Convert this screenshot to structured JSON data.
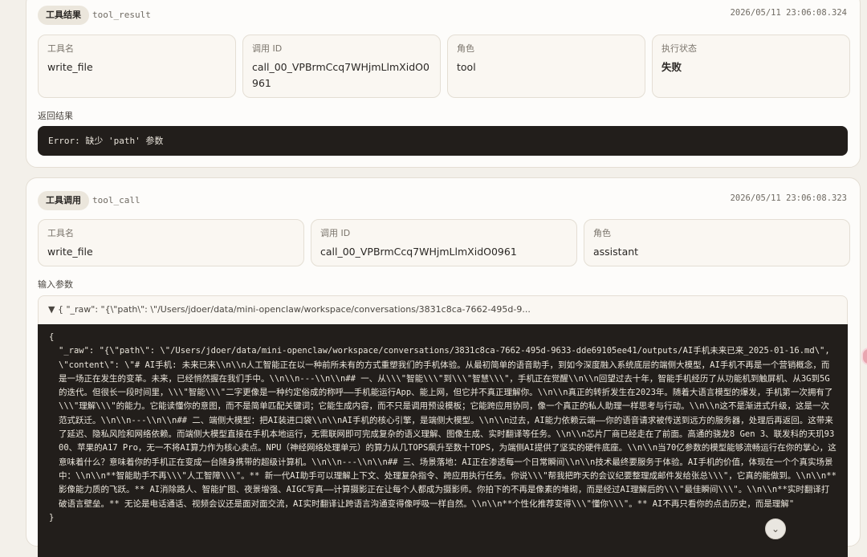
{
  "result_card": {
    "badge": "工具结果",
    "tag": "tool_result",
    "timestamp": "2026/05/11 23:06:08.324",
    "fields": [
      {
        "label": "工具名",
        "value": "write_file"
      },
      {
        "label": "调用 ID",
        "value": "call_00_VPBrmCcq7WHjmLlmXidO0961"
      },
      {
        "label": "角色",
        "value": "tool"
      },
      {
        "label": "执行状态",
        "value": "失败"
      }
    ],
    "return_label": "返回结果",
    "return_value": "Error: 缺少 'path' 参数"
  },
  "call_card": {
    "badge": "工具调用",
    "tag": "tool_call",
    "timestamp": "2026/05/11 23:06:08.323",
    "fields": [
      {
        "label": "工具名",
        "value": "write_file"
      },
      {
        "label": "调用 ID",
        "value": "call_00_VPBrmCcq7WHjmLlmXidO0961"
      },
      {
        "label": "角色",
        "value": "assistant"
      }
    ],
    "params_label": "输入参数",
    "collapse_summary": "▼ { \"_raw\": \"{\\\"path\\\": \\\"/Users/jdoer/data/mini-openclaw/workspace/conversations/3831c8ca-7662-495d-9...",
    "json_open": "{",
    "json_body": "\"_raw\": \"{\\\"path\\\": \\\"/Users/jdoer/data/mini-openclaw/workspace/conversations/3831c8ca-7662-495d-9633-dde69105ee41/outputs/AI手机未来已来_2025-01-16.md\\\", \\\"content\\\": \\\"# AI手机: 未来已来\\\\n\\\\n人工智能正在以一种前所未有的方式重塑我们的手机体验。从最初简单的语音助手，到如今深度融入系统底层的端侧大模型，AI手机不再是一个营销概念，而是一场正在发生的变革。未来，已经悄然握在我们手中。\\\\n\\\\n---\\\\n\\\\n## 一、从\\\\\\\"智能\\\\\\\"到\\\\\\\"智慧\\\\\\\"，手机正在觉醒\\\\n\\\\n回望过去十年，智能手机经历了从功能机到触屏机、从3G到5G的迭代。但很长一段时间里，\\\\\\\"智能\\\\\\\"二字更像是一种约定俗成的称呼——手机能运行App、能上网，但它并不真正理解你。\\\\n\\\\n真正的转折发生在2023年。随着大语言模型的爆发，手机第一次拥有了\\\\\\\"理解\\\\\\\"的能力。它能读懂你的意图，而不是简单匹配关键词；它能生成内容，而不只是调用预设模板；它能跨应用协同，像一个真正的私人助理一样思考与行动。\\\\n\\\\n这不是渐进式升级，这是一次范式跃迁。\\\\n\\\\n---\\\\n\\\\n## 二、端侧大模型：把AI装进口袋\\\\n\\\\nAI手机的核心引擎，是端侧大模型。\\\\n\\\\n过去，AI能力依赖云端——你的语音请求被传送到远方的服务器，处理后再返回。这带来了延迟、隐私风险和网络依赖。而端侧大模型直接在手机本地运行，无需联网即可完成复杂的语义理解、图像生成、实时翻译等任务。\\\\n\\\\n芯片厂商已经走在了前面。高通的骁龙8 Gen 3、联发科的天玑9300、苹果的A17 Pro，无一不将AI算力作为核心卖点。NPU（神经网络处理单元）的算力从几TOPS飙升至数十TOPS，为端侧AI提供了坚实的硬件底座。\\\\n\\\\n当70亿参数的模型能够流畅运行在你的掌心，这意味着什么？意味着你的手机正在变成一台随身携带的超级计算机。\\\\n\\\\n---\\\\n\\\\n## 三、场景落地：AI正在渗透每一个日常瞬间\\\\n\\\\n技术最终要服务于体验。AI手机的价值，体现在一个个真实场景中：\\\\n\\\\n**智能助手不再\\\\\\\"人工智障\\\\\\\"。** 新一代AI助手可以理解上下文、处理复杂指令、跨应用执行任务。你说\\\\\\\"帮我把昨天的会议纪要整理成邮件发给张总\\\\\\\"，它真的能做到。\\\\n\\\\n**影像能力质的飞跃。** AI消除路人、智能扩图、夜景增强、AIGC写真——计算摄影正在让每个人都成为摄影师。你拍下的不再是像素的堆砌，而是经过AI理解后的\\\\\\\"最佳瞬间\\\\\\\"。\\\\n\\\\n**实时翻译打破语言壁垒。** 无论是电话通话、视频会议还是面对面交流，AI实时翻译让跨语言沟通变得像呼吸一样自然。\\\\n\\\\n**个性化推荐变得\\\\\\\"懂你\\\\\\\"。** AI不再只看你的点击历史，而是理解\"",
    "json_close": "}"
  },
  "scroll_button_icon": "chevron-down-icon"
}
